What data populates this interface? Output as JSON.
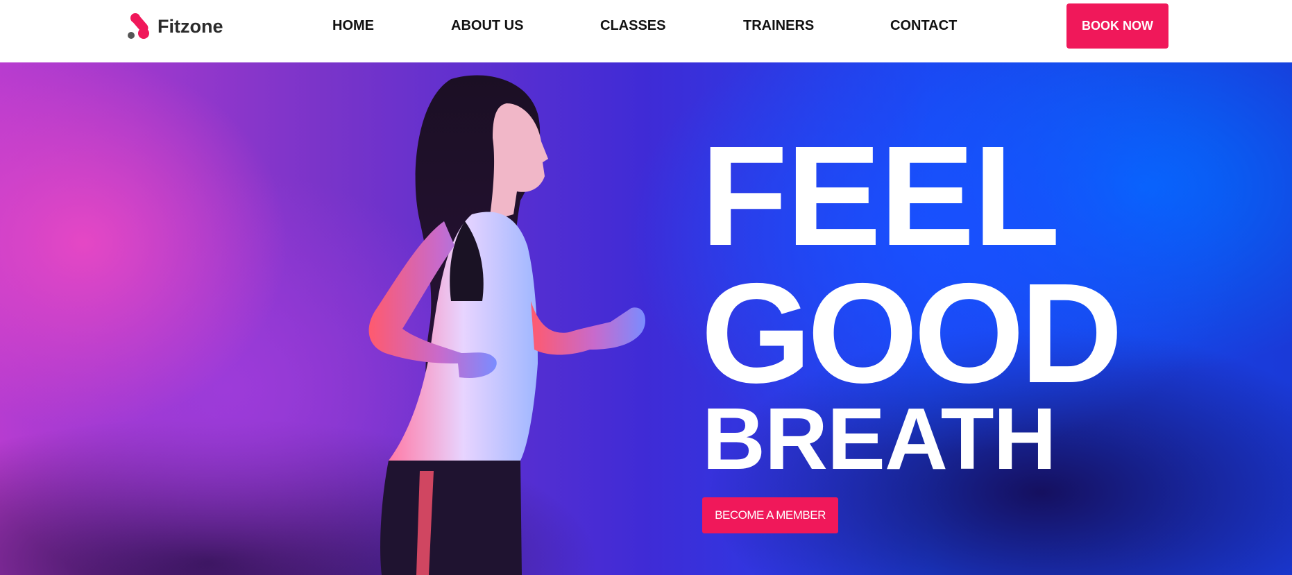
{
  "brand": {
    "name": "Fitzone",
    "logo_icon": "fitzone-logo-icon"
  },
  "nav": {
    "items": [
      {
        "label": "HOME"
      },
      {
        "label": "ABOUT US"
      },
      {
        "label": "CLASSES"
      },
      {
        "label": "TRAINERS"
      },
      {
        "label": "CONTACT"
      }
    ]
  },
  "header": {
    "cta_label": "BOOK NOW"
  },
  "hero": {
    "headline_line1": "FEEL",
    "headline_line2": "GOOD",
    "headline_line3": "BREATH",
    "cta_label": "BECOME A MEMBER",
    "image": "woman-running-photo"
  },
  "colors": {
    "accent": "#f0185a",
    "nav_text": "#111111",
    "hero_pink": "#e848c4",
    "hero_blue": "#1950ff"
  }
}
